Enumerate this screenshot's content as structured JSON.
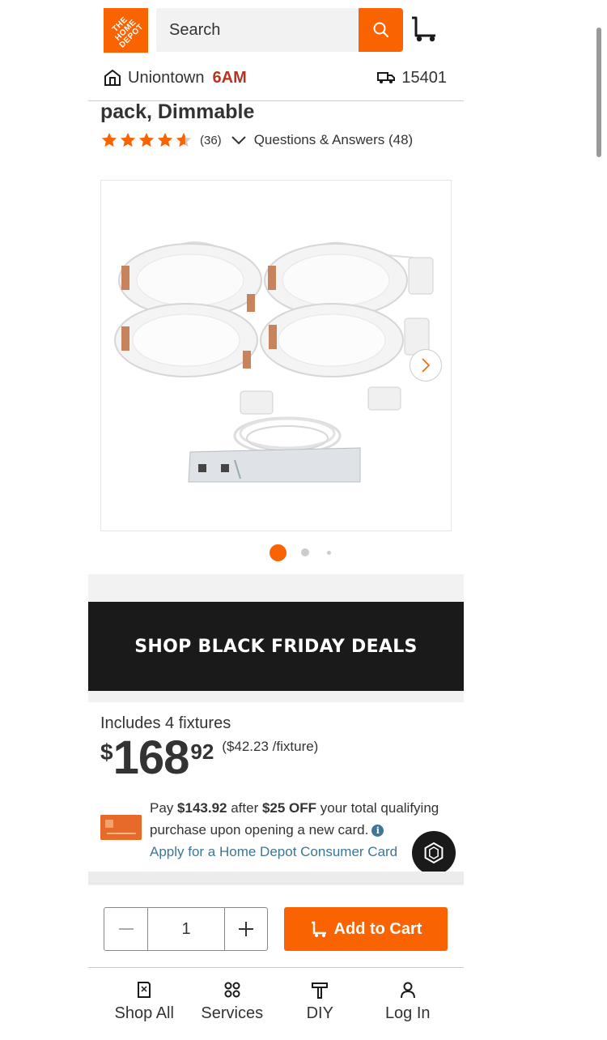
{
  "header": {
    "logo_text": "THE HOME DEPOT",
    "search_placeholder": "Search",
    "search_icon": "search-icon",
    "cart_icon": "cart-icon"
  },
  "store": {
    "name": "Uniontown",
    "time": "6AM",
    "zip": "15401",
    "store_icon": "store-icon",
    "truck_icon": "truck-icon"
  },
  "product": {
    "title": "pack, Dimmable",
    "rating": 4.6,
    "review_count": "(36)",
    "qa_link": "Questions & Answers (48)",
    "carousel_total": 3,
    "carousel_active": 1
  },
  "promo": {
    "label": "SHOP BLACK FRIDAY DEALS"
  },
  "pricing": {
    "includes": "Includes 4 fixtures",
    "currency": "$",
    "dollars": "168",
    "cents": "92",
    "unit_price": "($42.23 /fixture)"
  },
  "card_offer": {
    "pay_prefix": "Pay ",
    "pay_amount": "$143.92",
    "after": " after ",
    "discount": "$25 OFF",
    "rest": " your total qualifying purchase upon opening a new card.",
    "apply_link": "Apply for a Home Depot Consumer Card"
  },
  "cart_controls": {
    "quantity": "1",
    "add_to_cart": "Add to Cart"
  },
  "bottom_nav": {
    "items": [
      {
        "label": "Shop All",
        "icon": "shop-all-icon"
      },
      {
        "label": "Services",
        "icon": "services-icon"
      },
      {
        "label": "DIY",
        "icon": "diy-icon"
      },
      {
        "label": "Log In",
        "icon": "user-icon"
      }
    ]
  },
  "colors": {
    "brand_orange": "#f96302",
    "store_time_red": "#b5361f",
    "link_blue": "#3e7697",
    "promo_black": "#1a1a1a"
  }
}
